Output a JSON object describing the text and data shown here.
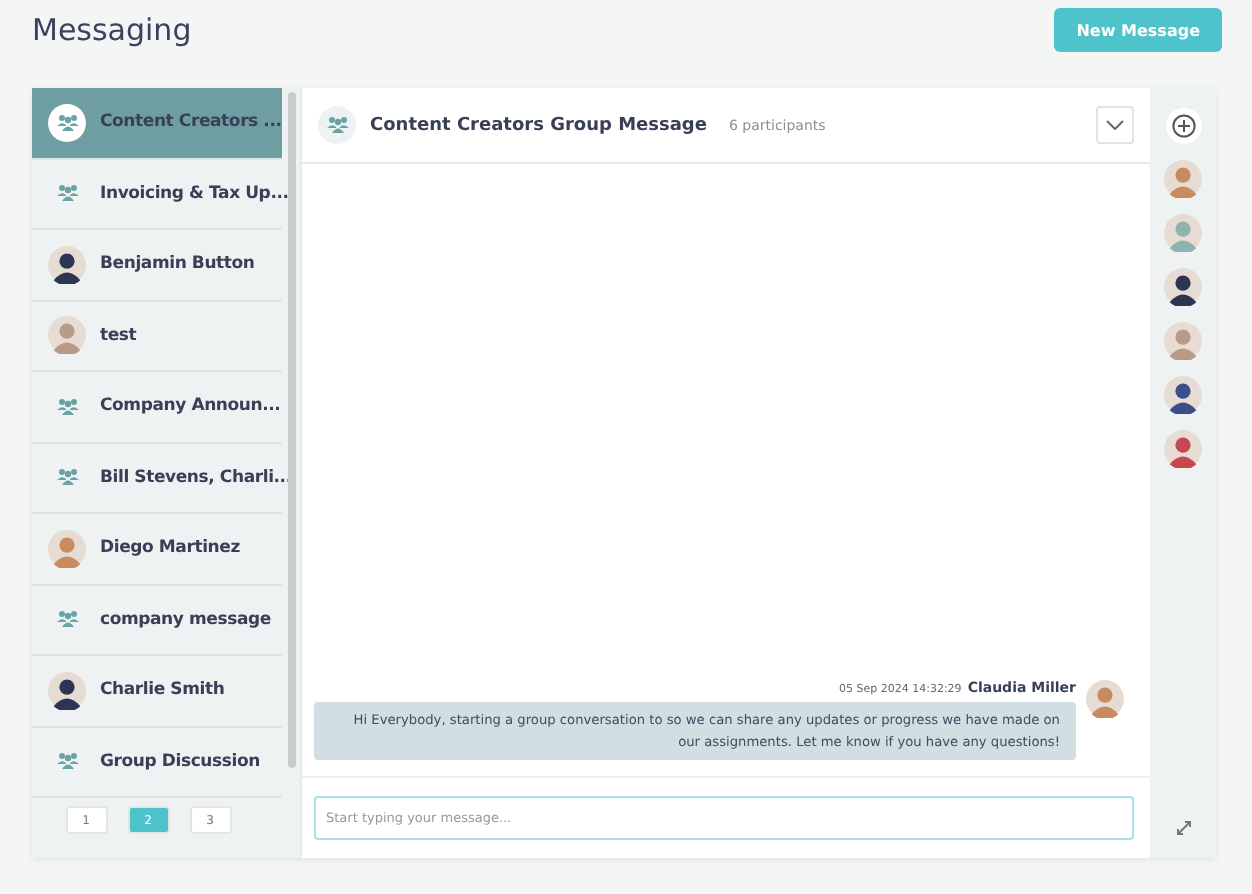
{
  "header": {
    "title": "Messaging",
    "new_button": "New Message"
  },
  "conversations": [
    {
      "label": "Content Creators ...",
      "kind": "group",
      "selected": true
    },
    {
      "label": "Invoicing & Tax Up...",
      "kind": "group",
      "selected": false
    },
    {
      "label": "Benjamin Button",
      "kind": "person",
      "selected": false
    },
    {
      "label": "test",
      "kind": "person",
      "selected": false
    },
    {
      "label": "Company Announ...",
      "kind": "group",
      "selected": false
    },
    {
      "label": "Bill Stevens, Charli...",
      "kind": "group",
      "selected": false
    },
    {
      "label": "Diego Martinez",
      "kind": "person",
      "selected": false
    },
    {
      "label": "company message",
      "kind": "group",
      "selected": false
    },
    {
      "label": "Charlie Smith",
      "kind": "person",
      "selected": false
    },
    {
      "label": "Group Discussion",
      "kind": "group",
      "selected": false
    }
  ],
  "pages": [
    {
      "label": "1",
      "selected": false
    },
    {
      "label": "2",
      "selected": true
    },
    {
      "label": "3",
      "selected": false
    }
  ],
  "chat": {
    "title": "Content Creators Group Message",
    "participants_count": "6 participants",
    "messages": [
      {
        "time": "05 Sep 2024 14:32:29",
        "author": "Claudia Miller",
        "text": "Hi Everybody, starting a group conversation to so we can share any updates or progress we have made on our assignments. Let me know if you have any questions!"
      }
    ],
    "composer": {
      "placeholder": "Start typing your message..."
    }
  },
  "participants": [
    {
      "kind": "avatar"
    },
    {
      "kind": "avatar"
    },
    {
      "kind": "avatar"
    },
    {
      "kind": "avatar"
    },
    {
      "kind": "avatar"
    },
    {
      "kind": "avatar"
    }
  ]
}
